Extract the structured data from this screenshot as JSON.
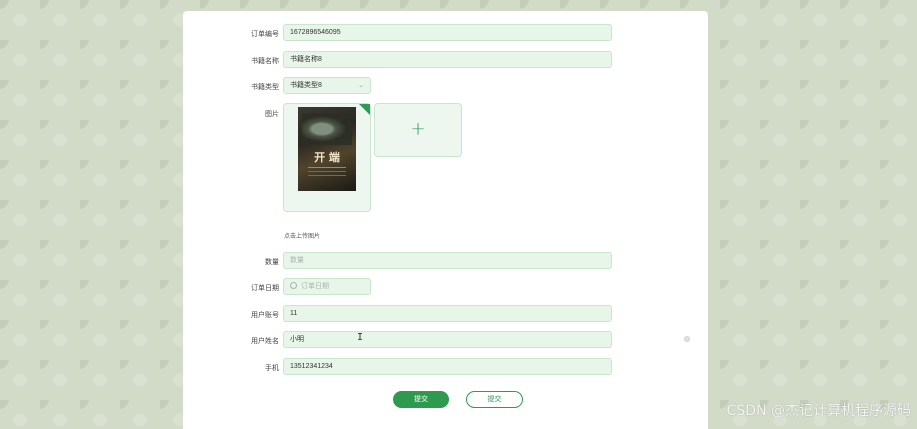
{
  "form": {
    "order_no": {
      "label": "订单编号",
      "value": "1672896546095"
    },
    "book_name": {
      "label": "书籍名称",
      "value": "书籍名称8"
    },
    "book_type": {
      "label": "书籍类型",
      "value": "书籍类型8"
    },
    "image": {
      "label": "图片",
      "book_title": "开 端",
      "hint": "点击上传图片",
      "upload_icon": "plus-icon"
    },
    "quantity": {
      "label": "数量",
      "placeholder": "数量"
    },
    "order_date": {
      "label": "订单日期",
      "placeholder": "订单日期"
    },
    "user_account": {
      "label": "用户账号",
      "value": "11"
    },
    "user_name": {
      "label": "用户姓名",
      "value": "小明"
    },
    "phone": {
      "label": "手机",
      "value": "13512341234"
    }
  },
  "buttons": {
    "submit": "提交",
    "cancel": "提交"
  },
  "watermark": "CSDN @杰记计算机程序源码",
  "colors": {
    "accent": "#2e9a4e",
    "field_bg": "#e8f6ea",
    "page_bg": "#d2dac8"
  }
}
